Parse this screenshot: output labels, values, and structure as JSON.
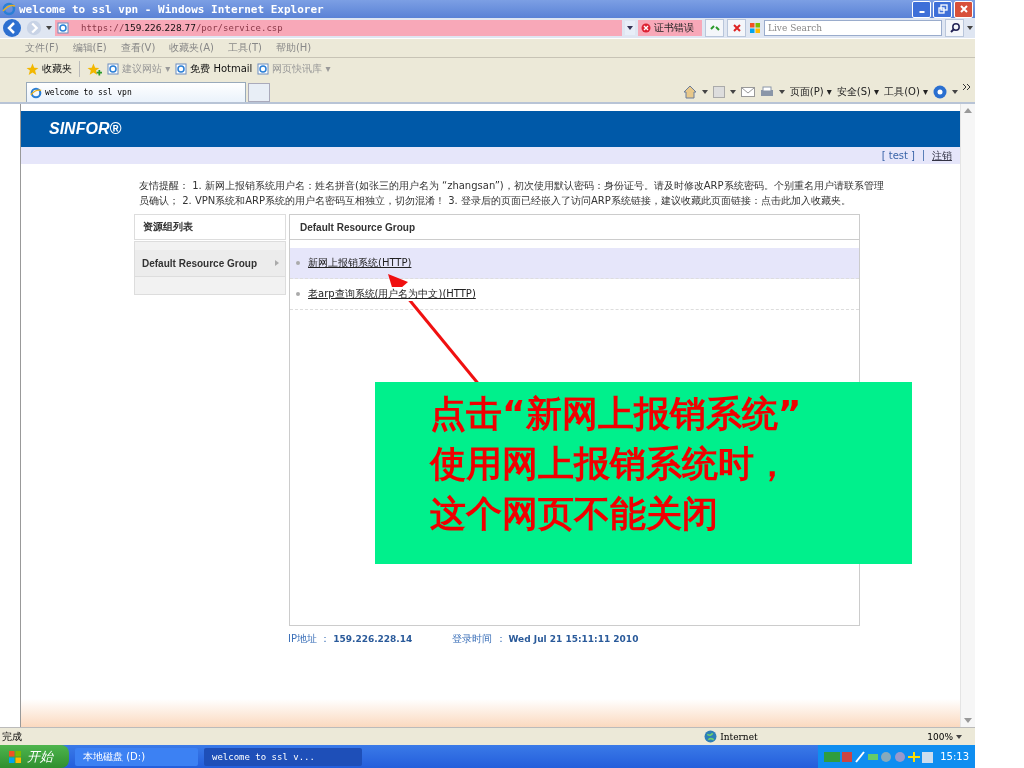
{
  "window": {
    "title": "welcome to ssl vpn - Windows Internet Explorer"
  },
  "address_bar": {
    "scheme": "https://",
    "host": "159.226.228.77",
    "path": "/por/service.csp",
    "cert_error": "证书错误",
    "search_placeholder": "Live Search"
  },
  "menu": [
    "文件(F)",
    "编辑(E)",
    "查看(V)",
    "收藏夹(A)",
    "工具(T)",
    "帮助(H)"
  ],
  "favorites_bar": [
    {
      "label": "收藏夹",
      "kind": "star"
    },
    {
      "label": "建议网站 ▾",
      "kind": "page"
    },
    {
      "label": "免费 Hotmail",
      "kind": "page"
    },
    {
      "label": "网页快讯库 ▾",
      "kind": "page"
    }
  ],
  "tab": {
    "title": "welcome to ssl vpn"
  },
  "command_bar": [
    "页面(P) ▾",
    "安全(S) ▾",
    "工具(O) ▾"
  ],
  "page": {
    "brand": "SINFOR®",
    "user": "[ test ]",
    "logout": "注销",
    "notice": [
      "友情提醒： 1. 新网上报销系统用户名：姓名拼音(如张三的用户名为 “zhangsan”)，初次使用默认密码：身份证号。请及时修改ARP系统密码。个别重名用户请联系管理",
      "员确认； 2. VPN系统和ARP系统的用户名密码互相独立，切勿混淆！ 3. 登录后的页面已经嵌入了访问ARP系统链接，建议收藏此页面链接：点击此加入收藏夹。"
    ],
    "sidebar": {
      "title": "资源组列表",
      "items": [
        {
          "label": "Default Resource Group",
          "selected": true
        }
      ]
    },
    "panel": {
      "title": "Default Resource Group",
      "resources": [
        {
          "label": "新网上报销系统(HTTP)",
          "selected": true
        },
        {
          "label": "老arp查询系统(用户名为中文)(HTTP)",
          "selected": false
        }
      ]
    },
    "footer": {
      "ip_label": "IP地址 ：",
      "ip": "159.226.228.14",
      "time_label": "登录时间 ：",
      "time": "Wed Jul 21 15:11:11 2010"
    }
  },
  "annotation": {
    "lines": [
      "点击“新网上报销系统”",
      "使用网上报销系统时，",
      "这个网页不能关闭"
    ]
  },
  "status_bar": {
    "text": "完成",
    "zone": "Internet",
    "zoom": "100%"
  },
  "taskbar": {
    "start": "开始",
    "tasks": [
      "本地磁盘 (D:)",
      "welcome to ssl v..."
    ],
    "clock": "15:13"
  }
}
